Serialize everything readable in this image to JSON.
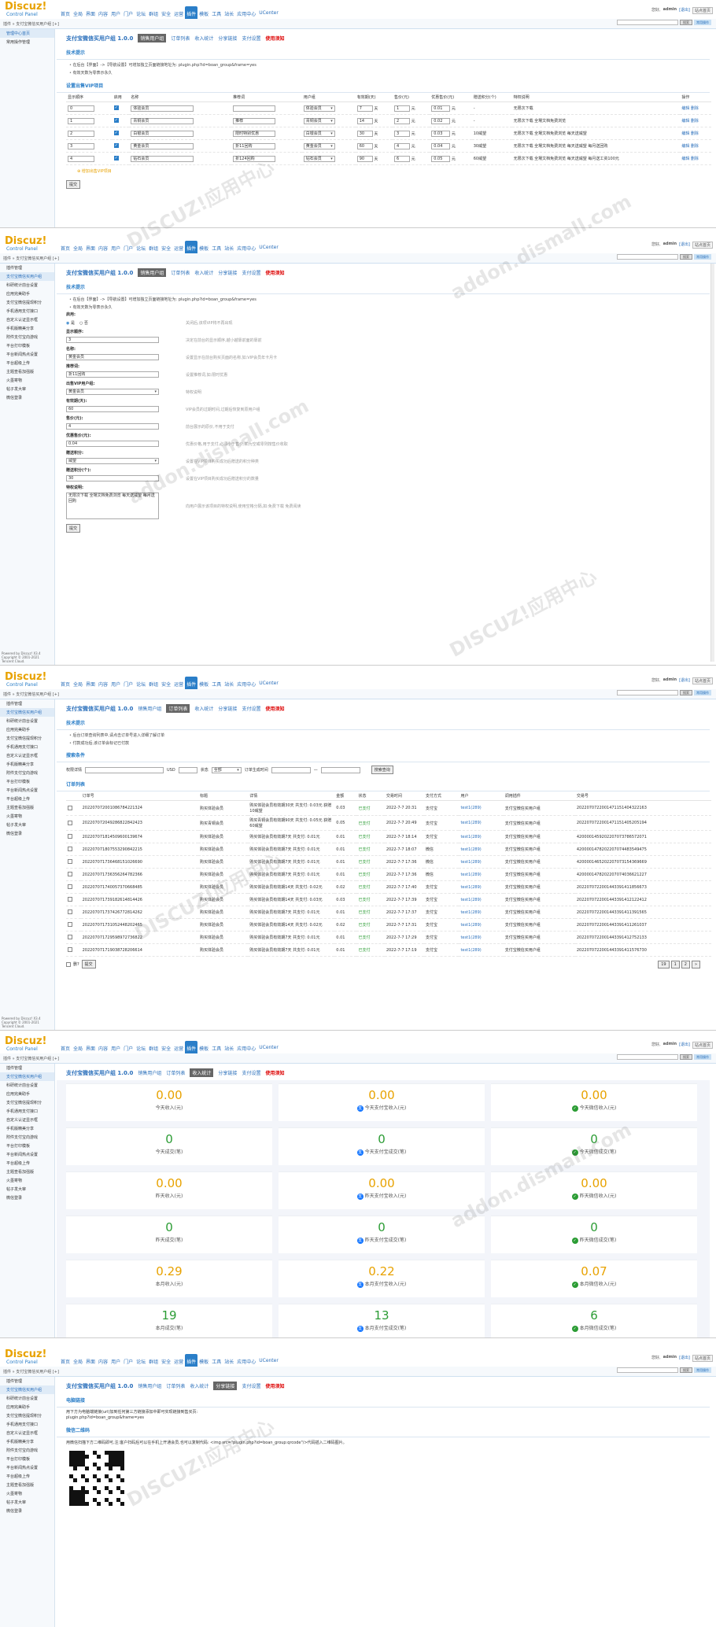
{
  "app": {
    "logo": "Discuz!",
    "logo_sub": "Control Panel",
    "greeting": "您好,",
    "user": "admin",
    "logout": "[退出]",
    "home": "站点首页"
  },
  "nav": [
    "首页",
    "全局",
    "界面",
    "内容",
    "用户",
    "门户",
    "论坛",
    "群组",
    "安全",
    "运营",
    "插件",
    "模板",
    "工具",
    "站长",
    "应用中心",
    "UCenter"
  ],
  "crumb": "插件 » 支付宝微信买用户组 [+]",
  "search_btn": "搜索",
  "search_btn2": "常用操作",
  "plugin_title": "支付宝微信买用户组 1.0.0",
  "tabs": [
    "销售用户组",
    "订单列表",
    "收入统计",
    "分享链接",
    "支付设置",
    "使用须知"
  ],
  "sidebar1": [
    "管理中心首页",
    "常用操作管理"
  ],
  "sidebar": [
    "插件管理",
    "支付宝微信买用户组",
    "科研统计前台设置",
    "应用完美助手",
    "支付宝微信提现积分",
    "手机通用支付接口",
    "自定义认证显示框",
    "手机版精美分享",
    "附件支付宝向游戏",
    "平台打印模板",
    "平台新闻热点设置",
    "平台超级上传",
    "主题查看加强版",
    "火墨寄物",
    "帖子发大审",
    "微信登录"
  ],
  "sidebar3": [
    "插件管理",
    "支付宝微信买用户组",
    "科研统计前台设置",
    "应用完美助手",
    "支付宝微信提现积分",
    "手机通用支付接口",
    "自定义认证显示框",
    "手机版精美分享",
    "附件支付宝向游戏",
    "平台打印模板",
    "平台新闻热点设置",
    "平台超级上传",
    "主题查看加强版",
    "火墨寄物",
    "帖子发大审",
    "微信登录"
  ],
  "powered": "Powered by Discuz! X3.4\nCopyright © 2001-2021\nTencent Cloud.",
  "s1": {
    "sec1": "技术提示",
    "tips": [
      "在后台【界面】->【导航设置】可增加独立页面链接地址为: plugin.php?id=boan_group&frame=yes",
      "有效天数为零表示永久"
    ],
    "sec2": "设置出售VIP项目",
    "cols": [
      "显示顺序",
      "启用",
      "名称",
      "推荐词",
      "用户组",
      "有效期(天)",
      "售价(元)",
      "优惠售价(元)",
      "赠送积分(个)",
      "特权说明",
      "操作"
    ],
    "unit_day": "天",
    "unit_yuan": "元",
    "unit_yuan2": "元",
    "rows": [
      {
        "order": "0",
        "name": "体验会员",
        "rec": "",
        "group": "体验会员",
        "days": "7",
        "price": "1",
        "sale": "0.01",
        "gift": "-",
        "desc": "无限次下载",
        "op1": "编辑",
        "op2": "删除"
      },
      {
        "order": "1",
        "name": "青铜会员",
        "rec": "推荐",
        "group": "青铜会员",
        "days": "14",
        "price": "2",
        "sale": "0.02",
        "gift": "-",
        "desc": "无限次下载 全場文档免费浏览",
        "op1": "编辑",
        "op2": "删除"
      },
      {
        "order": "2",
        "name": "白银会员",
        "rec": "限时特别优惠",
        "group": "白银会员",
        "days": "30",
        "price": "3",
        "sale": "0.03",
        "gift": "10威望",
        "desc": "无限次下载 全場文档免费浏览 每天送威望",
        "op1": "编辑",
        "op2": "删除"
      },
      {
        "order": "3",
        "name": "黄金会员",
        "rec": "折11回购",
        "group": "黄金会员",
        "days": "60",
        "price": "4",
        "sale": "0.04",
        "gift": "30威望",
        "desc": "无限次下载 全場文档免费浏览 每天送威望 每月送回购",
        "op1": "编辑",
        "op2": "删除"
      },
      {
        "order": "4",
        "name": "钻石会员",
        "rec": "折124回购",
        "group": "钻石会员",
        "days": "90",
        "price": "6",
        "sale": "0.05",
        "gift": "60威望",
        "desc": "无限次下载 全場文档免费浏览 每天送威望 每月送工资100元",
        "op1": "编辑",
        "op2": "删除"
      }
    ],
    "add": "增加出售VIP项目",
    "submit": "提交"
  },
  "s2": {
    "sec": "技术提示",
    "tips": [
      "在后台【界面】->【导航设置】可增加独立页面链接地址为: plugin.php?id=boan_group&frame=yes",
      "有效天数为零表示永久"
    ],
    "fields": [
      {
        "label": "启用:",
        "value": "",
        "type": "radio",
        "yes": "是",
        "no": "否",
        "desc": "关闭后,该项VIP将不再出现"
      },
      {
        "label": "显示顺序:",
        "value": "3",
        "type": "input",
        "desc": "决定在前台的显示顺序,越小越靠前面的靠前"
      },
      {
        "label": "名称:",
        "value": "黄金会员",
        "type": "input",
        "desc": "设置显示在前台购买页面的名称,如:VIP会员年卡月卡"
      },
      {
        "label": "推荐词:",
        "value": "折11回购",
        "type": "input",
        "desc": "设置推荐词,如:限时优惠"
      },
      {
        "label": "出售VIP用户组:",
        "value": "黄金会员",
        "type": "select",
        "desc": "特权说明"
      },
      {
        "label": "有效期(天):",
        "value": "60",
        "type": "input",
        "desc": "VIP会员的过期时间,过期后恢复到原用户组"
      },
      {
        "label": "售价(元):",
        "value": "4",
        "type": "input",
        "desc": "前台展示的原价,不用于支付"
      },
      {
        "label": "优惠售价(元):",
        "value": "0.04",
        "type": "input",
        "desc": "优惠价格,用于支付,必须小于售价,如为空或零则按售价收取"
      },
      {
        "label": "赠送积分:",
        "value": "威望",
        "type": "select",
        "desc": "设置在VIP项目购买成功后赠送的积分种类"
      },
      {
        "label": "赠送积分(个):",
        "value": "30",
        "type": "input",
        "desc": "设置在VIP项目购买成功后赠送积分的数量"
      },
      {
        "label": "特权说明:",
        "value": "无限次下载 全場文档免费浏览 每天送威望 每月送回购",
        "type": "textarea",
        "desc": "向用户展示该项目的特权说明,使用空格分隔,如:免费下载 免费阅读"
      }
    ],
    "submit": "提交"
  },
  "s3": {
    "sec1": "技术提示",
    "tips": [
      "后台订单查询列表中,请点击订单号进入详细了解订单",
      "付款成功后,该订单会标记已付款"
    ],
    "sec2": "搜索条件",
    "filter": {
      "label1": "权限详情",
      "label2": "USD",
      "label3": "状态",
      "status": "全部",
      "label4": "订单生成时间",
      "search": "搜索查询"
    },
    "sec3": "订单列表",
    "cols": [
      "",
      "订单号",
      "标题",
      "详情",
      "金额",
      "状态",
      "交易时间",
      "支付方式",
      "用户",
      "调用插件",
      "交易号"
    ],
    "rows": [
      {
        "no": "202207072001086784221324",
        "title": "购买体验会员",
        "detail": "购买体验会员有效期30天 共支付: 0.03元 获赠10威望",
        "amt": "0.03",
        "st": "已支付",
        "t": "2022-7-7 20:31",
        "pay": "支付宝",
        "user": "test1(289)",
        "plug": "支付宝微信买用户组",
        "tx": "2022070722001471151404322163"
      },
      {
        "no": "202207072049286822842423",
        "title": "购买青铜会员",
        "detail": "购买青铜会员有效期90天 共支付: 0.05元 获赠60威望",
        "amt": "0.05",
        "st": "已支付",
        "t": "2022-7-7 20:49",
        "pay": "支付宝",
        "user": "test1(289)",
        "plug": "支付宝微信买用户组",
        "tx": "2022070722001471151405205194"
      },
      {
        "no": "202207071814509600139674",
        "title": "购买体验会员",
        "detail": "购买体验会员有效期7天 共支付: 0.01元",
        "amt": "0.01",
        "st": "已支付",
        "t": "2022-7-7 18:14",
        "pay": "支付宝",
        "user": "test1(289)",
        "plug": "支付宝微信买用户组",
        "tx": "4200001459202207073786572071"
      },
      {
        "no": "202207071807553290842215",
        "title": "购买体验会员",
        "detail": "购买体验会员有效期7天 共支付: 0.01元",
        "amt": "0.01",
        "st": "已支付",
        "t": "2022-7-7 18:07",
        "pay": "微信",
        "user": "test1(289)",
        "plug": "支付宝微信买用户组",
        "tx": "4200001478202207074483549475"
      },
      {
        "no": "202207071736468151026690",
        "title": "购买体验会员",
        "detail": "购买体验会员有效期7天 共支付: 0.01元",
        "amt": "0.01",
        "st": "已支付",
        "t": "2022-7-7 17:36",
        "pay": "微信",
        "user": "test1(289)",
        "plug": "支付宝微信买用户组",
        "tx": "4200001465202207073154369669"
      },
      {
        "no": "202207071736356264782366",
        "title": "购买体验会员",
        "detail": "购买体验会员有效期7天 共支付: 0.01元",
        "amt": "0.01",
        "st": "已支付",
        "t": "2022-7-7 17:36",
        "pay": "微信",
        "user": "test1(289)",
        "plug": "支付宝微信买用户组",
        "tx": "4200001478202207074036621227"
      },
      {
        "no": "202207071740057370668485",
        "title": "购买体验会员",
        "detail": "购买体验会员有效期14天 共支付: 0.02元",
        "amt": "0.02",
        "st": "已支付",
        "t": "2022-7-7 17:40",
        "pay": "支付宝",
        "user": "test1(289)",
        "plug": "支付宝微信买用户组",
        "tx": "2022070722001443391411856673"
      },
      {
        "no": "202207071739182614814426",
        "title": "购买体验会员",
        "detail": "购买体验会员有效期14天 共支付: 0.03元",
        "amt": "0.03",
        "st": "已支付",
        "t": "2022-7-7 17:39",
        "pay": "支付宝",
        "user": "test1(289)",
        "plug": "支付宝微信买用户组",
        "tx": "2022070722001443391412122412"
      },
      {
        "no": "202207071737426772814262",
        "title": "购买体验会员",
        "detail": "购买体验会员有效期7天 共支付: 0.01元",
        "amt": "0.01",
        "st": "已支付",
        "t": "2022-7-7 17:37",
        "pay": "支付宝",
        "user": "test1(289)",
        "plug": "支付宝微信买用户组",
        "tx": "2022070722001443391411391565"
      },
      {
        "no": "202207071731052448202465",
        "title": "购买体验会员",
        "detail": "购买体验会员有效期14天 共支付: 0.02元",
        "amt": "0.02",
        "st": "已支付",
        "t": "2022-7-7 17:31",
        "pay": "支付宝",
        "user": "test1(289)",
        "plug": "支付宝微信买用户组",
        "tx": "2022070722001443391411261037"
      },
      {
        "no": "202207071729598972736822",
        "title": "购买体验会员",
        "detail": "购买体验会员有效期7天 共支付: 0.01元",
        "amt": "0.01",
        "st": "已支付",
        "t": "2022-7-7 17:29",
        "pay": "支付宝",
        "user": "test1(289)",
        "plug": "支付宝微信买用户组",
        "tx": "2022070722001443391412752133"
      },
      {
        "no": "202207071719038728206614",
        "title": "购买体验会员",
        "detail": "购买体验会员有效期7天 共支付: 0.01元",
        "amt": "0.01",
        "st": "已支付",
        "t": "2022-7-7 17:19",
        "pay": "支付宝",
        "user": "test1(289)",
        "plug": "支付宝微信买用户组",
        "tx": "2022070722001443391411576730"
      }
    ],
    "delete_label": "删?",
    "submit": "提交",
    "pager": [
      "19",
      "1",
      "2",
      "»"
    ]
  },
  "s4": {
    "cards": [
      {
        "v": "0.00",
        "l": "今天收入(元)",
        "ic": ""
      },
      {
        "v": "0.00",
        "l": "今天支付宝收入(元)",
        "ic": "a"
      },
      {
        "v": "0.00",
        "l": "今天微信收入(元)",
        "ic": "w"
      },
      {
        "v": "0",
        "l": "今天成交(笔)",
        "ic": ""
      },
      {
        "v": "0",
        "l": "今天支付宝成交(笔)",
        "ic": "a"
      },
      {
        "v": "0",
        "l": "今天微信成交(笔)",
        "ic": "w"
      },
      {
        "v": "0.00",
        "l": "昨天收入(元)",
        "ic": ""
      },
      {
        "v": "0.00",
        "l": "昨天支付宝收入(元)",
        "ic": "a"
      },
      {
        "v": "0.00",
        "l": "昨天微信收入(元)",
        "ic": "w"
      },
      {
        "v": "0",
        "l": "昨天成交(笔)",
        "ic": ""
      },
      {
        "v": "0",
        "l": "昨天支付宝成交(笔)",
        "ic": "a"
      },
      {
        "v": "0",
        "l": "昨天微信成交(笔)",
        "ic": "w"
      },
      {
        "v": "0.29",
        "l": "本月收入(元)",
        "ic": ""
      },
      {
        "v": "0.22",
        "l": "本月支付宝收入(元)",
        "ic": "a"
      },
      {
        "v": "0.07",
        "l": "本月微信收入(元)",
        "ic": "w"
      },
      {
        "v": "19",
        "l": "本月成交(笔)",
        "ic": ""
      },
      {
        "v": "13",
        "l": "本月支付宝成交(笔)",
        "ic": "a"
      },
      {
        "v": "6",
        "l": "本月微信成交(笔)",
        "ic": "w"
      }
    ]
  },
  "s5": {
    "sec1": "电脑链接",
    "line1": "用下方为电脑端链接(url)加到任何第三方链接添加中即可实现链接到售买页:",
    "line2": "plugin.php?id=boan_group&frame=yes",
    "sec2": "微信二维码",
    "line3": "用微信扫描下方二维码即可,注:客户扫码后可以在手机上开通会员,也可以复制代码: <img src=\"plugin.php?id=boan_group:qrcode\"/>代码插入二维码图片。"
  },
  "watermark": "DISCUZ!应用中心",
  "watermark2": "addon.dismall.com"
}
